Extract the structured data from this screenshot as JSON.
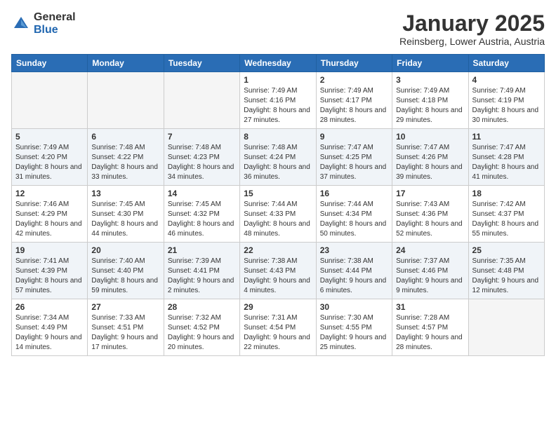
{
  "logo": {
    "general": "General",
    "blue": "Blue"
  },
  "title": "January 2025",
  "location": "Reinsberg, Lower Austria, Austria",
  "weekdays": [
    "Sunday",
    "Monday",
    "Tuesday",
    "Wednesday",
    "Thursday",
    "Friday",
    "Saturday"
  ],
  "weeks": [
    [
      {
        "day": "",
        "sunrise": "",
        "sunset": "",
        "daylight": ""
      },
      {
        "day": "",
        "sunrise": "",
        "sunset": "",
        "daylight": ""
      },
      {
        "day": "",
        "sunrise": "",
        "sunset": "",
        "daylight": ""
      },
      {
        "day": "1",
        "sunrise": "Sunrise: 7:49 AM",
        "sunset": "Sunset: 4:16 PM",
        "daylight": "Daylight: 8 hours and 27 minutes."
      },
      {
        "day": "2",
        "sunrise": "Sunrise: 7:49 AM",
        "sunset": "Sunset: 4:17 PM",
        "daylight": "Daylight: 8 hours and 28 minutes."
      },
      {
        "day": "3",
        "sunrise": "Sunrise: 7:49 AM",
        "sunset": "Sunset: 4:18 PM",
        "daylight": "Daylight: 8 hours and 29 minutes."
      },
      {
        "day": "4",
        "sunrise": "Sunrise: 7:49 AM",
        "sunset": "Sunset: 4:19 PM",
        "daylight": "Daylight: 8 hours and 30 minutes."
      }
    ],
    [
      {
        "day": "5",
        "sunrise": "Sunrise: 7:49 AM",
        "sunset": "Sunset: 4:20 PM",
        "daylight": "Daylight: 8 hours and 31 minutes."
      },
      {
        "day": "6",
        "sunrise": "Sunrise: 7:48 AM",
        "sunset": "Sunset: 4:22 PM",
        "daylight": "Daylight: 8 hours and 33 minutes."
      },
      {
        "day": "7",
        "sunrise": "Sunrise: 7:48 AM",
        "sunset": "Sunset: 4:23 PM",
        "daylight": "Daylight: 8 hours and 34 minutes."
      },
      {
        "day": "8",
        "sunrise": "Sunrise: 7:48 AM",
        "sunset": "Sunset: 4:24 PM",
        "daylight": "Daylight: 8 hours and 36 minutes."
      },
      {
        "day": "9",
        "sunrise": "Sunrise: 7:47 AM",
        "sunset": "Sunset: 4:25 PM",
        "daylight": "Daylight: 8 hours and 37 minutes."
      },
      {
        "day": "10",
        "sunrise": "Sunrise: 7:47 AM",
        "sunset": "Sunset: 4:26 PM",
        "daylight": "Daylight: 8 hours and 39 minutes."
      },
      {
        "day": "11",
        "sunrise": "Sunrise: 7:47 AM",
        "sunset": "Sunset: 4:28 PM",
        "daylight": "Daylight: 8 hours and 41 minutes."
      }
    ],
    [
      {
        "day": "12",
        "sunrise": "Sunrise: 7:46 AM",
        "sunset": "Sunset: 4:29 PM",
        "daylight": "Daylight: 8 hours and 42 minutes."
      },
      {
        "day": "13",
        "sunrise": "Sunrise: 7:45 AM",
        "sunset": "Sunset: 4:30 PM",
        "daylight": "Daylight: 8 hours and 44 minutes."
      },
      {
        "day": "14",
        "sunrise": "Sunrise: 7:45 AM",
        "sunset": "Sunset: 4:32 PM",
        "daylight": "Daylight: 8 hours and 46 minutes."
      },
      {
        "day": "15",
        "sunrise": "Sunrise: 7:44 AM",
        "sunset": "Sunset: 4:33 PM",
        "daylight": "Daylight: 8 hours and 48 minutes."
      },
      {
        "day": "16",
        "sunrise": "Sunrise: 7:44 AM",
        "sunset": "Sunset: 4:34 PM",
        "daylight": "Daylight: 8 hours and 50 minutes."
      },
      {
        "day": "17",
        "sunrise": "Sunrise: 7:43 AM",
        "sunset": "Sunset: 4:36 PM",
        "daylight": "Daylight: 8 hours and 52 minutes."
      },
      {
        "day": "18",
        "sunrise": "Sunrise: 7:42 AM",
        "sunset": "Sunset: 4:37 PM",
        "daylight": "Daylight: 8 hours and 55 minutes."
      }
    ],
    [
      {
        "day": "19",
        "sunrise": "Sunrise: 7:41 AM",
        "sunset": "Sunset: 4:39 PM",
        "daylight": "Daylight: 8 hours and 57 minutes."
      },
      {
        "day": "20",
        "sunrise": "Sunrise: 7:40 AM",
        "sunset": "Sunset: 4:40 PM",
        "daylight": "Daylight: 8 hours and 59 minutes."
      },
      {
        "day": "21",
        "sunrise": "Sunrise: 7:39 AM",
        "sunset": "Sunset: 4:41 PM",
        "daylight": "Daylight: 9 hours and 2 minutes."
      },
      {
        "day": "22",
        "sunrise": "Sunrise: 7:38 AM",
        "sunset": "Sunset: 4:43 PM",
        "daylight": "Daylight: 9 hours and 4 minutes."
      },
      {
        "day": "23",
        "sunrise": "Sunrise: 7:38 AM",
        "sunset": "Sunset: 4:44 PM",
        "daylight": "Daylight: 9 hours and 6 minutes."
      },
      {
        "day": "24",
        "sunrise": "Sunrise: 7:37 AM",
        "sunset": "Sunset: 4:46 PM",
        "daylight": "Daylight: 9 hours and 9 minutes."
      },
      {
        "day": "25",
        "sunrise": "Sunrise: 7:35 AM",
        "sunset": "Sunset: 4:48 PM",
        "daylight": "Daylight: 9 hours and 12 minutes."
      }
    ],
    [
      {
        "day": "26",
        "sunrise": "Sunrise: 7:34 AM",
        "sunset": "Sunset: 4:49 PM",
        "daylight": "Daylight: 9 hours and 14 minutes."
      },
      {
        "day": "27",
        "sunrise": "Sunrise: 7:33 AM",
        "sunset": "Sunset: 4:51 PM",
        "daylight": "Daylight: 9 hours and 17 minutes."
      },
      {
        "day": "28",
        "sunrise": "Sunrise: 7:32 AM",
        "sunset": "Sunset: 4:52 PM",
        "daylight": "Daylight: 9 hours and 20 minutes."
      },
      {
        "day": "29",
        "sunrise": "Sunrise: 7:31 AM",
        "sunset": "Sunset: 4:54 PM",
        "daylight": "Daylight: 9 hours and 22 minutes."
      },
      {
        "day": "30",
        "sunrise": "Sunrise: 7:30 AM",
        "sunset": "Sunset: 4:55 PM",
        "daylight": "Daylight: 9 hours and 25 minutes."
      },
      {
        "day": "31",
        "sunrise": "Sunrise: 7:28 AM",
        "sunset": "Sunset: 4:57 PM",
        "daylight": "Daylight: 9 hours and 28 minutes."
      },
      {
        "day": "",
        "sunrise": "",
        "sunset": "",
        "daylight": ""
      }
    ]
  ]
}
